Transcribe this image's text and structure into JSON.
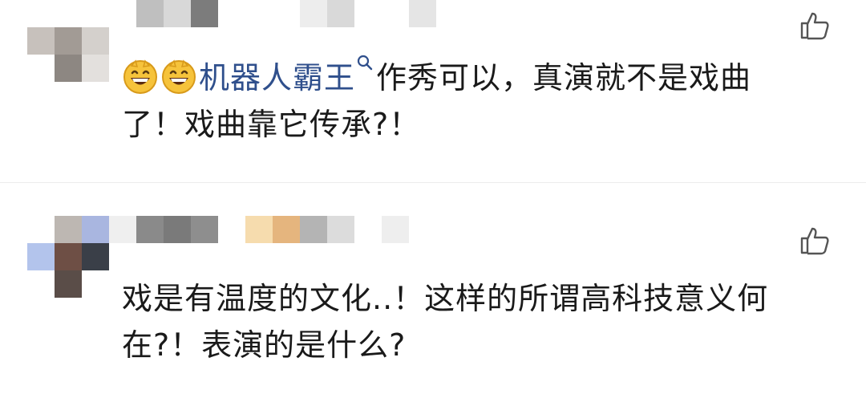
{
  "comments": [
    {
      "mention_name": "机器人霸王",
      "text_line_1": "作秀可以，真演就不是戏曲",
      "text_line_2": "了！戏曲靠它传承?！",
      "username_hidden": true
    },
    {
      "text_line_1": "戏是有温度的文化..！这样的所谓高科技意义何",
      "text_line_2": "在?！表演的是什么?",
      "username_hidden": true
    }
  ],
  "colors": {
    "mention": "#2f4f8c",
    "text": "#1a1a1a",
    "emoji_face": "#f6c33b"
  },
  "icons": {
    "like": "thumbs-up-icon",
    "emoji": "grinning-face-emoji",
    "mention_search": "search-icon"
  }
}
